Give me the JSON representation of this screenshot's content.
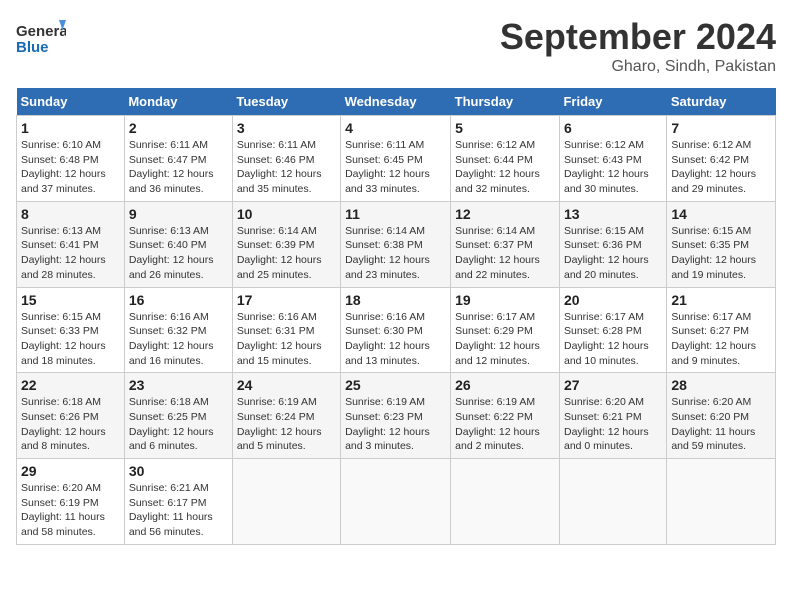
{
  "header": {
    "logo_text_general": "General",
    "logo_text_blue": "Blue",
    "month_title": "September 2024",
    "location": "Gharo, Sindh, Pakistan"
  },
  "calendar": {
    "days_of_week": [
      "Sunday",
      "Monday",
      "Tuesday",
      "Wednesday",
      "Thursday",
      "Friday",
      "Saturday"
    ],
    "weeks": [
      [
        {
          "num": "",
          "info": ""
        },
        {
          "num": "",
          "info": ""
        },
        {
          "num": "",
          "info": ""
        },
        {
          "num": "",
          "info": ""
        },
        {
          "num": "",
          "info": ""
        },
        {
          "num": "",
          "info": ""
        },
        {
          "num": "",
          "info": ""
        }
      ]
    ],
    "cells": [
      {
        "day": 1,
        "col": 0,
        "info": "Sunrise: 6:10 AM\nSunset: 6:48 PM\nDaylight: 12 hours\nand 37 minutes."
      },
      {
        "day": 2,
        "col": 1,
        "info": "Sunrise: 6:11 AM\nSunset: 6:47 PM\nDaylight: 12 hours\nand 36 minutes."
      },
      {
        "day": 3,
        "col": 2,
        "info": "Sunrise: 6:11 AM\nSunset: 6:46 PM\nDaylight: 12 hours\nand 35 minutes."
      },
      {
        "day": 4,
        "col": 3,
        "info": "Sunrise: 6:11 AM\nSunset: 6:45 PM\nDaylight: 12 hours\nand 33 minutes."
      },
      {
        "day": 5,
        "col": 4,
        "info": "Sunrise: 6:12 AM\nSunset: 6:44 PM\nDaylight: 12 hours\nand 32 minutes."
      },
      {
        "day": 6,
        "col": 5,
        "info": "Sunrise: 6:12 AM\nSunset: 6:43 PM\nDaylight: 12 hours\nand 30 minutes."
      },
      {
        "day": 7,
        "col": 6,
        "info": "Sunrise: 6:12 AM\nSunset: 6:42 PM\nDaylight: 12 hours\nand 29 minutes."
      },
      {
        "day": 8,
        "col": 0,
        "info": "Sunrise: 6:13 AM\nSunset: 6:41 PM\nDaylight: 12 hours\nand 28 minutes."
      },
      {
        "day": 9,
        "col": 1,
        "info": "Sunrise: 6:13 AM\nSunset: 6:40 PM\nDaylight: 12 hours\nand 26 minutes."
      },
      {
        "day": 10,
        "col": 2,
        "info": "Sunrise: 6:14 AM\nSunset: 6:39 PM\nDaylight: 12 hours\nand 25 minutes."
      },
      {
        "day": 11,
        "col": 3,
        "info": "Sunrise: 6:14 AM\nSunset: 6:38 PM\nDaylight: 12 hours\nand 23 minutes."
      },
      {
        "day": 12,
        "col": 4,
        "info": "Sunrise: 6:14 AM\nSunset: 6:37 PM\nDaylight: 12 hours\nand 22 minutes."
      },
      {
        "day": 13,
        "col": 5,
        "info": "Sunrise: 6:15 AM\nSunset: 6:36 PM\nDaylight: 12 hours\nand 20 minutes."
      },
      {
        "day": 14,
        "col": 6,
        "info": "Sunrise: 6:15 AM\nSunset: 6:35 PM\nDaylight: 12 hours\nand 19 minutes."
      },
      {
        "day": 15,
        "col": 0,
        "info": "Sunrise: 6:15 AM\nSunset: 6:33 PM\nDaylight: 12 hours\nand 18 minutes."
      },
      {
        "day": 16,
        "col": 1,
        "info": "Sunrise: 6:16 AM\nSunset: 6:32 PM\nDaylight: 12 hours\nand 16 minutes."
      },
      {
        "day": 17,
        "col": 2,
        "info": "Sunrise: 6:16 AM\nSunset: 6:31 PM\nDaylight: 12 hours\nand 15 minutes."
      },
      {
        "day": 18,
        "col": 3,
        "info": "Sunrise: 6:16 AM\nSunset: 6:30 PM\nDaylight: 12 hours\nand 13 minutes."
      },
      {
        "day": 19,
        "col": 4,
        "info": "Sunrise: 6:17 AM\nSunset: 6:29 PM\nDaylight: 12 hours\nand 12 minutes."
      },
      {
        "day": 20,
        "col": 5,
        "info": "Sunrise: 6:17 AM\nSunset: 6:28 PM\nDaylight: 12 hours\nand 10 minutes."
      },
      {
        "day": 21,
        "col": 6,
        "info": "Sunrise: 6:17 AM\nSunset: 6:27 PM\nDaylight: 12 hours\nand 9 minutes."
      },
      {
        "day": 22,
        "col": 0,
        "info": "Sunrise: 6:18 AM\nSunset: 6:26 PM\nDaylight: 12 hours\nand 8 minutes."
      },
      {
        "day": 23,
        "col": 1,
        "info": "Sunrise: 6:18 AM\nSunset: 6:25 PM\nDaylight: 12 hours\nand 6 minutes."
      },
      {
        "day": 24,
        "col": 2,
        "info": "Sunrise: 6:19 AM\nSunset: 6:24 PM\nDaylight: 12 hours\nand 5 minutes."
      },
      {
        "day": 25,
        "col": 3,
        "info": "Sunrise: 6:19 AM\nSunset: 6:23 PM\nDaylight: 12 hours\nand 3 minutes."
      },
      {
        "day": 26,
        "col": 4,
        "info": "Sunrise: 6:19 AM\nSunset: 6:22 PM\nDaylight: 12 hours\nand 2 minutes."
      },
      {
        "day": 27,
        "col": 5,
        "info": "Sunrise: 6:20 AM\nSunset: 6:21 PM\nDaylight: 12 hours\nand 0 minutes."
      },
      {
        "day": 28,
        "col": 6,
        "info": "Sunrise: 6:20 AM\nSunset: 6:20 PM\nDaylight: 11 hours\nand 59 minutes."
      },
      {
        "day": 29,
        "col": 0,
        "info": "Sunrise: 6:20 AM\nSunset: 6:19 PM\nDaylight: 11 hours\nand 58 minutes."
      },
      {
        "day": 30,
        "col": 1,
        "info": "Sunrise: 6:21 AM\nSunset: 6:17 PM\nDaylight: 11 hours\nand 56 minutes."
      }
    ]
  }
}
